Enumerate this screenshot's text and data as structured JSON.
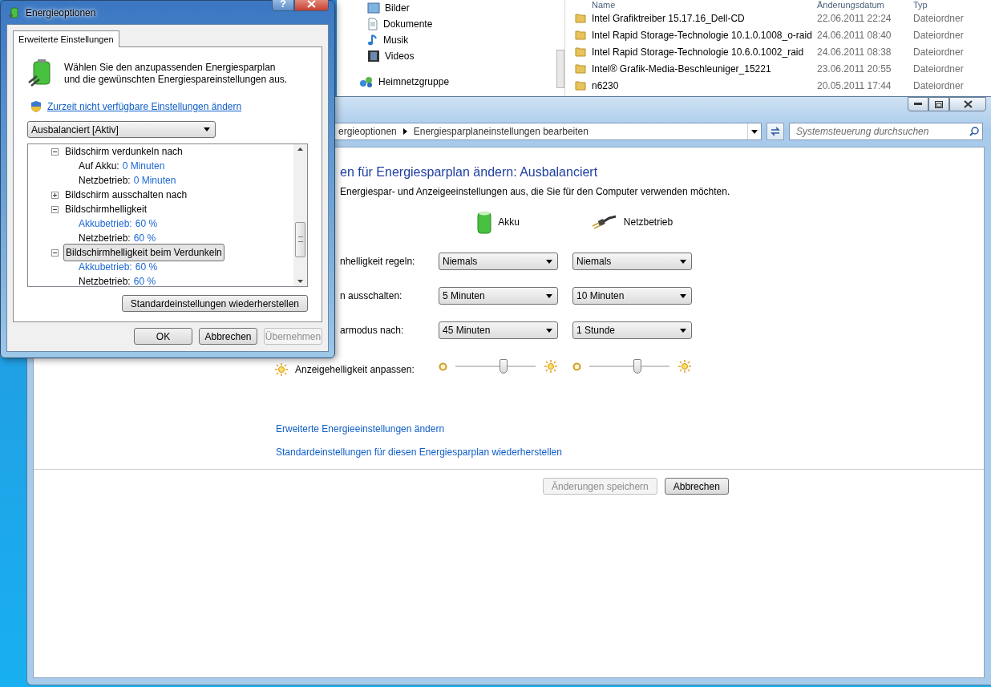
{
  "explorer": {
    "nav_items": [
      {
        "kind": "pictures",
        "label": "Bilder"
      },
      {
        "kind": "documents",
        "label": "Dokumente"
      },
      {
        "kind": "music",
        "label": "Musik"
      },
      {
        "kind": "videos",
        "label": "Videos"
      },
      {
        "kind": "homegroup",
        "label": "Heimnetzgruppe"
      }
    ],
    "columns": [
      "Name",
      "Änderungsdatum",
      "Typ"
    ],
    "rows": [
      {
        "name": "Intel Grafiktreiber 15.17.16_Dell-CD",
        "date": "22.06.2011 22:24",
        "type": "Dateiordner"
      },
      {
        "name": "Intel Rapid Storage-Technologie 10.1.0.1008_o-raid",
        "date": "24.06.2011 08:40",
        "type": "Dateiordner"
      },
      {
        "name": "Intel Rapid Storage-Technologie 10.6.0.1002_raid",
        "date": "24.06.2011 08:38",
        "type": "Dateiordner"
      },
      {
        "name": "Intel® Grafik-Media-Beschleuniger_15221",
        "date": "23.06.2011 20:55",
        "type": "Dateiordner"
      },
      {
        "name": "n6230",
        "date": "20.05.2011 17:44",
        "type": "Dateiordner"
      }
    ]
  },
  "control_panel": {
    "breadcrumb": [
      "ergieoptionen",
      "Energiesparplaneinstellungen bearbeiten"
    ],
    "search": {
      "placeholder": "Systemsteuerung durchsuchen"
    },
    "heading": "en für Energiesparplan ändern: Ausbalanciert",
    "description": "Energiespar- und Anzeigeeinstellungen aus, die Sie für den Computer verwenden möchten.",
    "power_sources": [
      {
        "kind": "battery",
        "label": "Akku"
      },
      {
        "kind": "plug",
        "label": "Netzbetrieb"
      }
    ],
    "settings": [
      {
        "kind": "dropdown",
        "label": "nhelligkeit regeln:",
        "values": [
          "Niemals",
          "Niemals"
        ]
      },
      {
        "kind": "dropdown",
        "label": "n ausschalten:",
        "values": [
          "5 Minuten",
          "10 Minuten"
        ]
      },
      {
        "kind": "dropdown",
        "label": "armodus nach:",
        "values": [
          "45 Minuten",
          "1 Stunde"
        ]
      },
      {
        "kind": "slider",
        "label": "Anzeigehelligkeit anpassen:",
        "sliders": [
          {
            "level": 0.6
          },
          {
            "level": 0.6
          }
        ]
      }
    ],
    "links": [
      "Erweiterte Energieeinstellungen ändern",
      "Standardeinstellungen für diesen Energiesparplan wiederherstellen"
    ],
    "buttons": [
      {
        "label": "Änderungen speichern",
        "disabled": true
      },
      {
        "label": "Abbrechen",
        "disabled": false
      }
    ]
  },
  "dialog": {
    "title": "Energieoptionen",
    "help": "?",
    "tabs": [
      {
        "label": "Erweiterte Einstellungen",
        "selected": true
      }
    ],
    "intro": "Wählen Sie den anzupassenden Energiesparplan und die gewünschten Energiespareinstellungen aus.",
    "link": "Zurzeit nicht verfügbare Einstellungen ändern",
    "plan_select": {
      "value": "Ausbalanciert [Aktiv]"
    },
    "tree": [
      {
        "label": "Bildschirm verdunkeln nach",
        "expanded": true,
        "selected": false,
        "children": [
          {
            "label": "Auf Akku:",
            "value": "0 Minuten",
            "highlighted": false
          },
          {
            "label": "Netzbetrieb:",
            "value": "0 Minuten",
            "highlighted": false
          }
        ]
      },
      {
        "label": "Bildschirm ausschalten nach",
        "expanded": false,
        "selected": false
      },
      {
        "label": "Bildschirmhelligkeit",
        "expanded": true,
        "selected": false,
        "children": [
          {
            "label": "Akkubetrieb:",
            "value": "60 %",
            "highlighted": true
          },
          {
            "label": "Netzbetrieb:",
            "value": "60 %",
            "highlighted": false
          }
        ]
      },
      {
        "label": "Bildschirmhelligkeit beim Verdunkeln",
        "expanded": true,
        "selected": true,
        "children": [
          {
            "label": "Akkubetrieb:",
            "value": "60 %",
            "highlighted": true
          },
          {
            "label": "Netzbetrieb:",
            "value": "60 %",
            "highlighted": false
          }
        ]
      }
    ],
    "restore_button": "Standardeinstellungen wiederherstellen",
    "buttons": [
      {
        "label": "OK",
        "disabled": false
      },
      {
        "label": "Abbrechen",
        "disabled": false
      },
      {
        "label": "Übernehmen",
        "disabled": true
      }
    ]
  }
}
